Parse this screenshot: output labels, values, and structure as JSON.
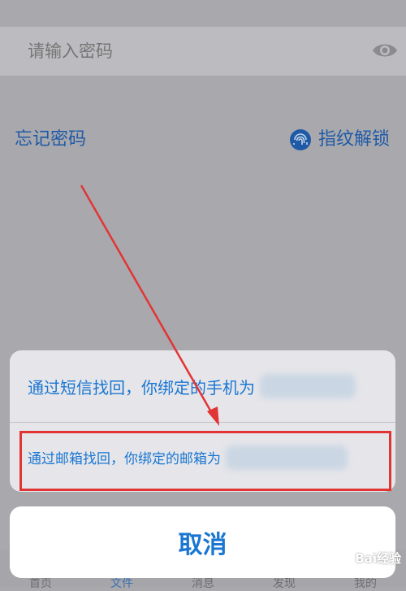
{
  "password": {
    "placeholder": "请输入密码",
    "toggle_icon": "eye-icon"
  },
  "links": {
    "forgot": "忘记密码",
    "fingerprint_label": "指纹解锁",
    "fingerprint_icon": "fingerprint-icon"
  },
  "tabbar": {
    "items": [
      {
        "label": "首页"
      },
      {
        "label": "文件"
      },
      {
        "label": "消息"
      },
      {
        "label": "发现"
      },
      {
        "label": "我的"
      }
    ]
  },
  "action_sheet": {
    "options": [
      {
        "label": "通过短信找回，你绑定的手机为"
      },
      {
        "label": "通过邮箱找回，你绑定的邮箱为"
      }
    ],
    "cancel": "取消"
  },
  "watermark": "Bai经验",
  "colors": {
    "accent": "#1976d2",
    "highlight": "#e13535"
  }
}
